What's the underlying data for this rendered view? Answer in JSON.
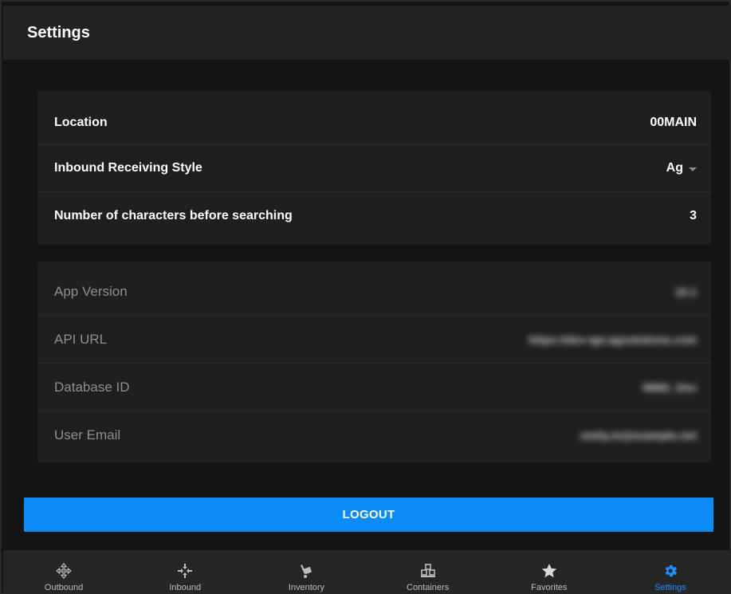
{
  "header": {
    "title": "Settings"
  },
  "settings": {
    "rows": [
      {
        "label": "Location",
        "value": "00MAIN"
      },
      {
        "label": "Inbound Receiving Style",
        "value": "Ag"
      },
      {
        "label": "Number of characters before searching",
        "value": "3"
      }
    ]
  },
  "info": {
    "rows": [
      {
        "label": "App Version",
        "value": "10.1"
      },
      {
        "label": "API URL",
        "value": "https://dev-api.agsolutions.com"
      },
      {
        "label": "Database ID",
        "value": "WMS_Dev"
      },
      {
        "label": "User Email",
        "value": "emily.m@example.net"
      }
    ]
  },
  "logout_label": "LOGOUT",
  "nav": {
    "items": [
      {
        "label": "Outbound",
        "icon": "outbound-icon"
      },
      {
        "label": "Inbound",
        "icon": "inbound-icon"
      },
      {
        "label": "Inventory",
        "icon": "inventory-icon"
      },
      {
        "label": "Containers",
        "icon": "containers-icon"
      },
      {
        "label": "Favorites",
        "icon": "star-icon"
      },
      {
        "label": "Settings",
        "icon": "gear-icon"
      }
    ],
    "active": "Settings",
    "active_color": "#1e90ff"
  },
  "colors": {
    "accent": "#0b8bf5",
    "background": "#141414",
    "card": "#1f1f1f"
  }
}
